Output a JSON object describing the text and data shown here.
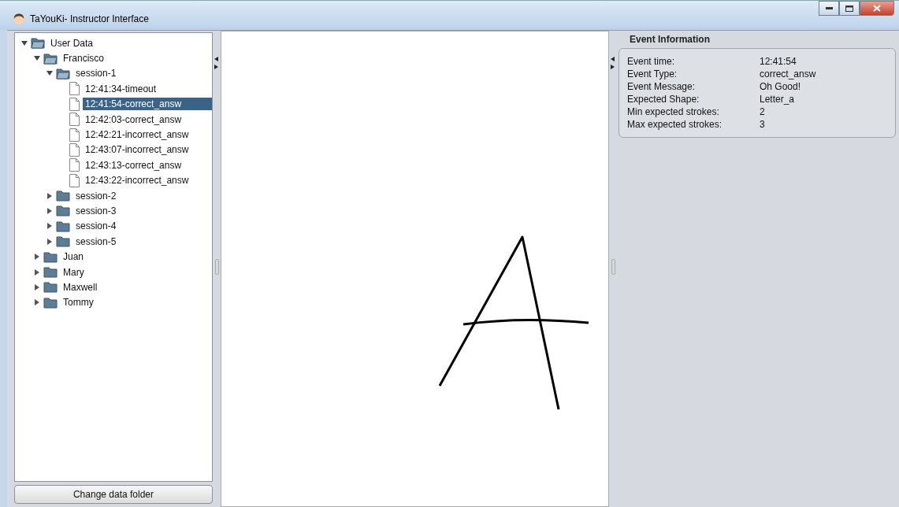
{
  "window": {
    "title": "TaYouKi- Instructor Interface"
  },
  "tree": {
    "label": "User Data",
    "kind": "folder",
    "expanded": true,
    "selected": false,
    "children": [
      {
        "label": "Francisco",
        "kind": "folder",
        "expanded": true,
        "selected": false,
        "children": [
          {
            "label": "session-1",
            "kind": "folder",
            "expanded": true,
            "selected": false,
            "children": [
              {
                "label": "12:41:34-timeout",
                "kind": "file",
                "selected": false
              },
              {
                "label": "12:41:54-correct_answ",
                "kind": "file",
                "selected": true
              },
              {
                "label": "12:42:03-correct_answ",
                "kind": "file",
                "selected": false
              },
              {
                "label": "12:42:21-incorrect_answ",
                "kind": "file",
                "selected": false
              },
              {
                "label": "12:43:07-incorrect_answ",
                "kind": "file",
                "selected": false
              },
              {
                "label": "12:43:13-correct_answ",
                "kind": "file",
                "selected": false
              },
              {
                "label": "12:43:22-incorrect_answ",
                "kind": "file",
                "selected": false
              }
            ]
          },
          {
            "label": "session-2",
            "kind": "folder",
            "expanded": false,
            "selected": false
          },
          {
            "label": "session-3",
            "kind": "folder",
            "expanded": false,
            "selected": false
          },
          {
            "label": "session-4",
            "kind": "folder",
            "expanded": false,
            "selected": false
          },
          {
            "label": "session-5",
            "kind": "folder",
            "expanded": false,
            "selected": false
          }
        ]
      },
      {
        "label": "Juan",
        "kind": "folder",
        "expanded": false,
        "selected": false
      },
      {
        "label": "Mary",
        "kind": "folder",
        "expanded": false,
        "selected": false
      },
      {
        "label": "Maxwell",
        "kind": "folder",
        "expanded": false,
        "selected": false
      },
      {
        "label": "Tommy",
        "kind": "folder",
        "expanded": false,
        "selected": false
      }
    ]
  },
  "change_folder_button": "Change data folder",
  "event_info": {
    "title": "Event Information",
    "fields": [
      {
        "label": "Event time:",
        "value": "12:41:54"
      },
      {
        "label": "Event Type:",
        "value": "correct_answ"
      },
      {
        "label": "Event Message:",
        "value": "Oh Good!"
      },
      {
        "label": "Expected Shape:",
        "value": "Letter_a"
      },
      {
        "label": "Min expected strokes:",
        "value": "2"
      },
      {
        "label": "Max expected strokes:",
        "value": "3"
      }
    ]
  }
}
